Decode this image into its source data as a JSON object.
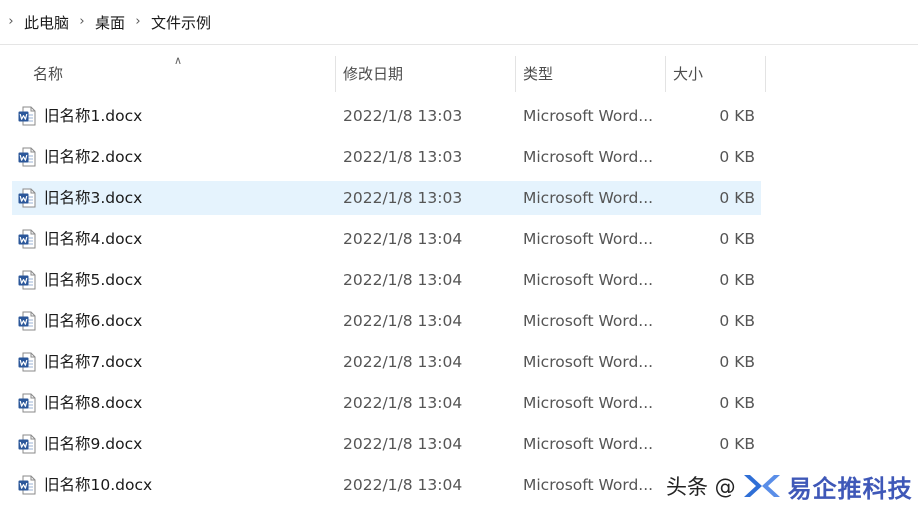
{
  "breadcrumb": {
    "items": [
      "此电脑",
      "桌面",
      "文件示例"
    ]
  },
  "columns": {
    "name": "名称",
    "date": "修改日期",
    "type": "类型",
    "size": "大小"
  },
  "files": [
    {
      "name": "旧名称1.docx",
      "date": "2022/1/8 13:03",
      "type": "Microsoft Word...",
      "size": "0 KB"
    },
    {
      "name": "旧名称2.docx",
      "date": "2022/1/8 13:03",
      "type": "Microsoft Word...",
      "size": "0 KB"
    },
    {
      "name": "旧名称3.docx",
      "date": "2022/1/8 13:03",
      "type": "Microsoft Word...",
      "size": "0 KB",
      "selected": true
    },
    {
      "name": "旧名称4.docx",
      "date": "2022/1/8 13:04",
      "type": "Microsoft Word...",
      "size": "0 KB"
    },
    {
      "name": "旧名称5.docx",
      "date": "2022/1/8 13:04",
      "type": "Microsoft Word...",
      "size": "0 KB"
    },
    {
      "name": "旧名称6.docx",
      "date": "2022/1/8 13:04",
      "type": "Microsoft Word...",
      "size": "0 KB"
    },
    {
      "name": "旧名称7.docx",
      "date": "2022/1/8 13:04",
      "type": "Microsoft Word...",
      "size": "0 KB"
    },
    {
      "name": "旧名称8.docx",
      "date": "2022/1/8 13:04",
      "type": "Microsoft Word...",
      "size": "0 KB"
    },
    {
      "name": "旧名称9.docx",
      "date": "2022/1/8 13:04",
      "type": "Microsoft Word...",
      "size": "0 KB"
    },
    {
      "name": "旧名称10.docx",
      "date": "2022/1/8 13:04",
      "type": "Microsoft Word...",
      "size": ""
    }
  ],
  "file_icon": "word-document-icon",
  "watermark": {
    "prefix": "头条 @",
    "brand": "易企推科技"
  },
  "colors": {
    "selected_row": "#e5f3fd",
    "word_blue": "#2b579a",
    "brand_blue": "#3f58b8"
  }
}
